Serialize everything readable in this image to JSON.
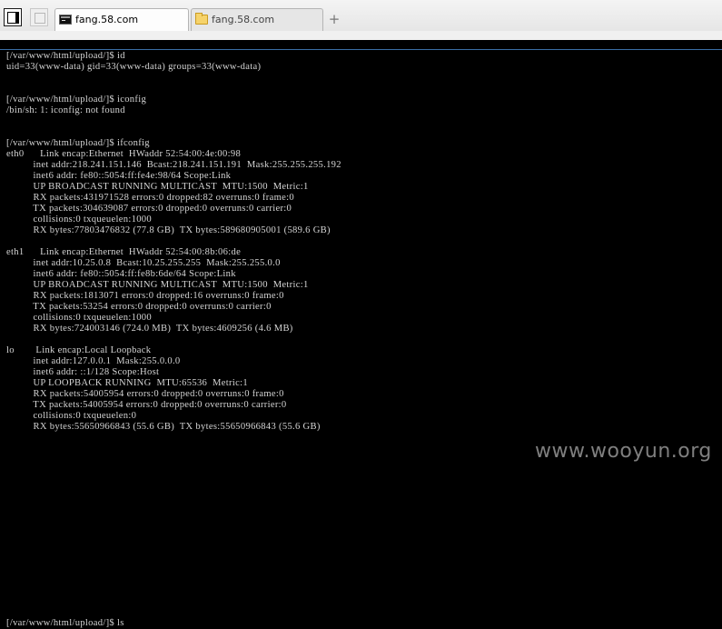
{
  "tabs": [
    {
      "title": "fang.58.com",
      "icon": "terminal-icon",
      "active": true
    },
    {
      "title": "fang.58.com",
      "icon": "folder-icon",
      "active": false
    }
  ],
  "new_tab_label": "+",
  "terminal": {
    "lines": [
      "[/var/www/html/upload/]$ id",
      "uid=33(www-data) gid=33(www-data) groups=33(www-data)",
      "",
      "",
      "[/var/www/html/upload/]$ iconfig",
      "/bin/sh: 1: iconfig: not found",
      "",
      "",
      "[/var/www/html/upload/]$ ifconfig",
      "eth0      Link encap:Ethernet  HWaddr 52:54:00:4e:00:98",
      "          inet addr:218.241.151.146  Bcast:218.241.151.191  Mask:255.255.255.192",
      "          inet6 addr: fe80::5054:ff:fe4e:98/64 Scope:Link",
      "          UP BROADCAST RUNNING MULTICAST  MTU:1500  Metric:1",
      "          RX packets:431971528 errors:0 dropped:82 overruns:0 frame:0",
      "          TX packets:304639087 errors:0 dropped:0 overruns:0 carrier:0",
      "          collisions:0 txqueuelen:1000",
      "          RX bytes:77803476832 (77.8 GB)  TX bytes:589680905001 (589.6 GB)",
      "",
      "eth1      Link encap:Ethernet  HWaddr 52:54:00:8b:06:de",
      "          inet addr:10.25.0.8  Bcast:10.25.255.255  Mask:255.255.0.0",
      "          inet6 addr: fe80::5054:ff:fe8b:6de/64 Scope:Link",
      "          UP BROADCAST RUNNING MULTICAST  MTU:1500  Metric:1",
      "          RX packets:1813071 errors:0 dropped:16 overruns:0 frame:0",
      "          TX packets:53254 errors:0 dropped:0 overruns:0 carrier:0",
      "          collisions:0 txqueuelen:1000",
      "          RX bytes:724003146 (724.0 MB)  TX bytes:4609256 (4.6 MB)",
      "",
      "lo        Link encap:Local Loopback",
      "          inet addr:127.0.0.1  Mask:255.0.0.0",
      "          inet6 addr: ::1/128 Scope:Host",
      "          UP LOOPBACK RUNNING  MTU:65536  Metric:1",
      "          RX packets:54005954 errors:0 dropped:0 overruns:0 frame:0",
      "          TX packets:54005954 errors:0 dropped:0 overruns:0 carrier:0",
      "          collisions:0 txqueuelen:0",
      "          RX bytes:55650966843 (55.6 GB)  TX bytes:55650966843 (55.6 GB)",
      "",
      "",
      "",
      "",
      "",
      "",
      "",
      "",
      "",
      "",
      "",
      "",
      "",
      "",
      "",
      "",
      "",
      "[/var/www/html/upload/]$ ls"
    ]
  },
  "watermark": "www.wooyun.org",
  "colors": {
    "terminal_bg": "#000000",
    "terminal_fg": "#d4d4d4",
    "tabbar_bg": "#ececec"
  }
}
